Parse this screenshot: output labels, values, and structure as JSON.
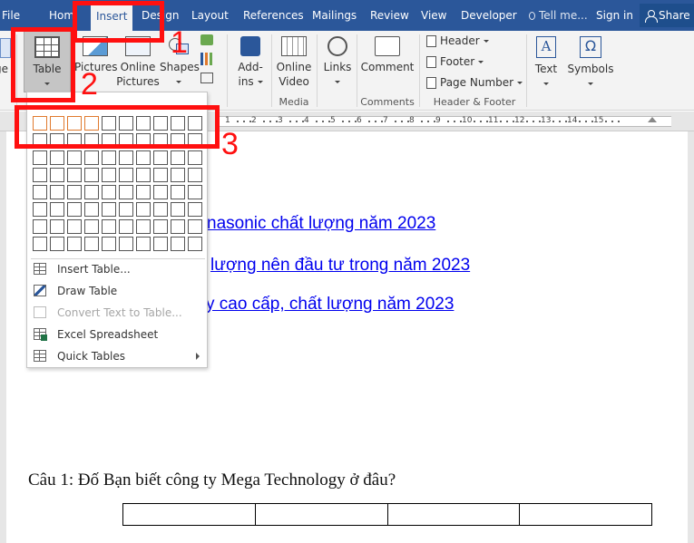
{
  "tabs": [
    {
      "label": "File",
      "active": false
    },
    {
      "label": "Hom",
      "active": false
    },
    {
      "label": "Insert",
      "active": true
    },
    {
      "label": "Design",
      "active": false
    },
    {
      "label": "Layout",
      "active": false
    },
    {
      "label": "References",
      "active": false
    },
    {
      "label": "Mailings",
      "active": false
    },
    {
      "label": "Review",
      "active": false
    },
    {
      "label": "View",
      "active": false
    },
    {
      "label": "Developer",
      "active": false
    }
  ],
  "tell_me": "Tell me...",
  "sign_in": "Sign in",
  "share": "Share",
  "ribbon": {
    "pages_partial": "ge",
    "table": "Table",
    "pictures": "Pictures",
    "online_pictures_1": "Online",
    "online_pictures_2": "Pictures",
    "shapes": "Shapes",
    "addins_1": "Add-",
    "addins_2": "ins",
    "online_video_1": "Online",
    "online_video_2": "Video",
    "media_group": "Media",
    "links": "Links",
    "comment": "Comment",
    "comments_group": "Comments",
    "header": "Header",
    "footer": "Footer",
    "page_number": "Page Number",
    "header_footer_group": "Header & Footer",
    "text": "Text",
    "symbols": "Symbols",
    "symbols_glyph": "Ω"
  },
  "ruler_numbers": [
    "1",
    "2",
    "3",
    "4",
    "5",
    "6",
    "7",
    "8",
    "9",
    "10",
    "11",
    "12",
    "13",
    "14",
    "15"
  ],
  "dropdown": {
    "title": "Table",
    "grid_rows": 8,
    "grid_cols": 10,
    "highlight_rows": 1,
    "highlight_cols": 4,
    "items": [
      {
        "label": "Insert Table...",
        "icon": "table-grid-icon",
        "disabled": false,
        "submenu": false
      },
      {
        "label": "Draw Table",
        "icon": "pencil-icon",
        "disabled": false,
        "submenu": false
      },
      {
        "label": "Convert Text to Table...",
        "icon": "convert-text-icon",
        "disabled": true,
        "submenu": false
      },
      {
        "label": "Excel Spreadsheet",
        "icon": "excel-icon",
        "disabled": false,
        "submenu": false
      },
      {
        "label": "Quick Tables",
        "icon": "quick-table-icon",
        "disabled": false,
        "submenu": true
      }
    ]
  },
  "document": {
    "links": [
      "nasonic chất lượng năm 2023",
      "lượng nên đầu tư trong năm 2023",
      "y cao cấp, chất lượng năm 2023"
    ],
    "question": "Câu 1: Đố Bạn biết công ty Mega Technology ở đâu?",
    "table_cols": 4
  },
  "annotations": [
    "1",
    "2",
    "3"
  ],
  "colors": {
    "accent": "#2b579a",
    "annotation_red": "#ff1010",
    "link": "#0000ee",
    "grid_highlight": "#e07a2e"
  }
}
